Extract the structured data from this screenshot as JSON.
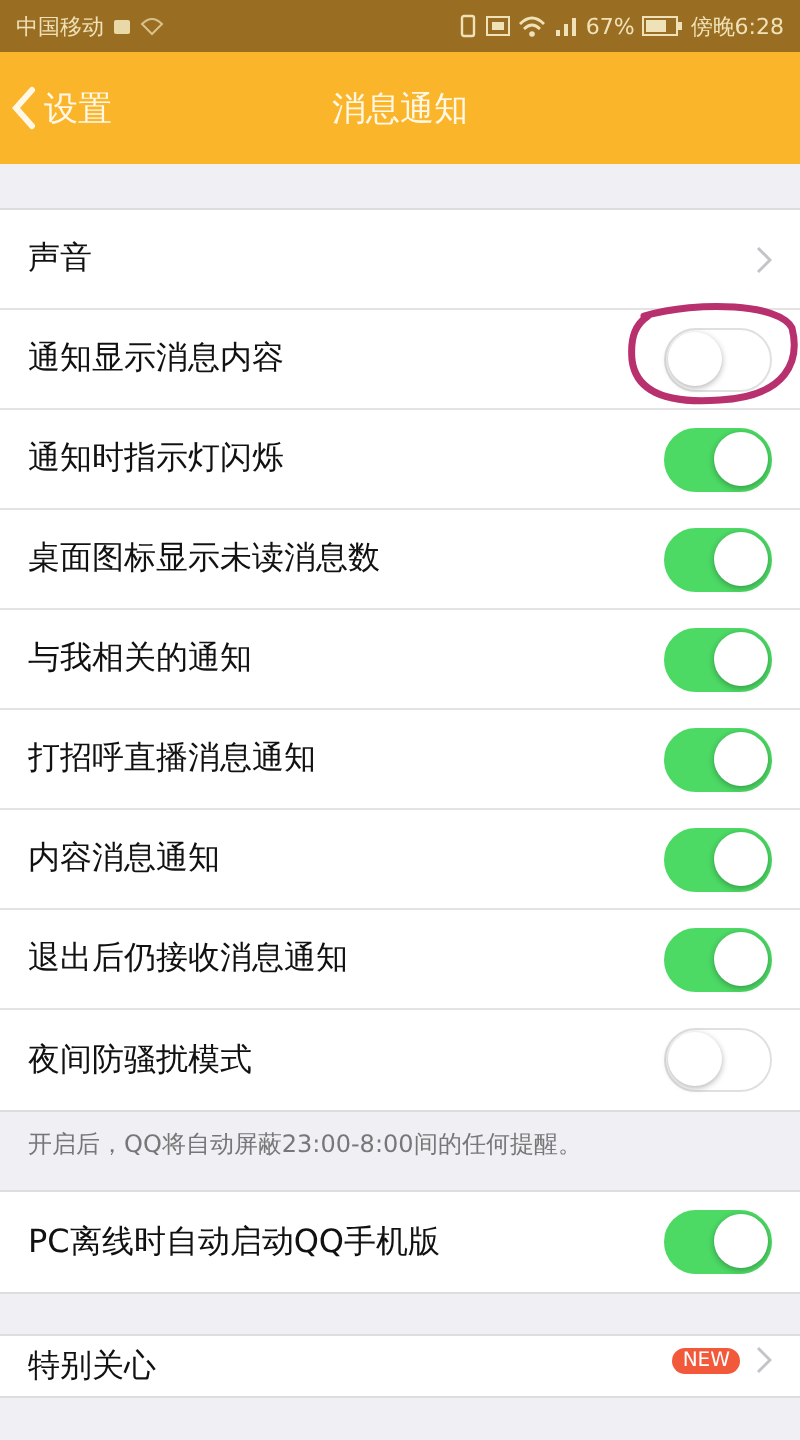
{
  "status_bar": {
    "carrier": "中国移动",
    "battery": "67%",
    "time": "傍晚6:28"
  },
  "nav": {
    "back": "设置",
    "title": "消息通知"
  },
  "groups": [
    {
      "rows": [
        {
          "kind": "link",
          "label": "声音"
        },
        {
          "kind": "toggle",
          "label": "通知显示消息内容",
          "on": false,
          "annotated": true
        },
        {
          "kind": "toggle",
          "label": "通知时指示灯闪烁",
          "on": true
        },
        {
          "kind": "toggle",
          "label": "桌面图标显示未读消息数",
          "on": true
        },
        {
          "kind": "toggle",
          "label": "与我相关的通知",
          "on": true
        },
        {
          "kind": "toggle",
          "label": "打招呼直播消息通知",
          "on": true
        },
        {
          "kind": "toggle",
          "label": "内容消息通知",
          "on": true
        },
        {
          "kind": "toggle",
          "label": "退出后仍接收消息通知",
          "on": true
        },
        {
          "kind": "toggle",
          "label": "夜间防骚扰模式",
          "on": false
        }
      ],
      "note": "开启后，QQ将自动屏蔽23:00-8:00间的任何提醒。"
    },
    {
      "rows": [
        {
          "kind": "toggle",
          "label": "PC离线时自动启动QQ手机版",
          "on": true
        }
      ]
    },
    {
      "rows": [
        {
          "kind": "link",
          "label": "特别关心",
          "badge": "NEW"
        }
      ]
    }
  ]
}
